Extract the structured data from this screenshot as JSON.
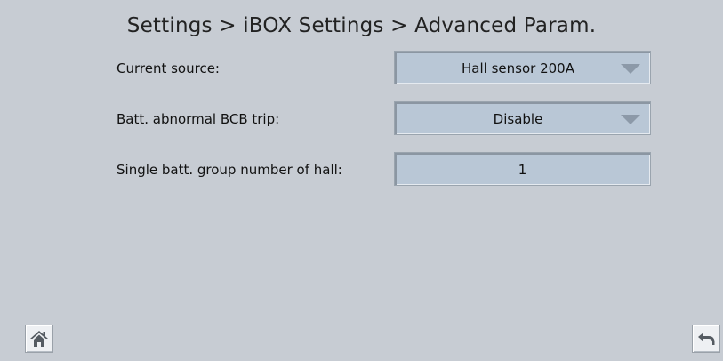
{
  "breadcrumb": "Settings > iBOX Settings > Advanced Param.",
  "params": [
    {
      "label": "Current source:",
      "value": "Hall sensor 200A",
      "type": "select"
    },
    {
      "label": "Batt. abnormal BCB trip:",
      "value": "Disable",
      "type": "select"
    },
    {
      "label": "Single batt. group number of hall:",
      "value": "1",
      "type": "input"
    }
  ],
  "icons": {
    "home": "home-icon",
    "back": "back-arrow-icon"
  },
  "colors": {
    "background": "#c7ccd3",
    "field": "#b9c7d6",
    "arrow": "#8c99a8"
  }
}
